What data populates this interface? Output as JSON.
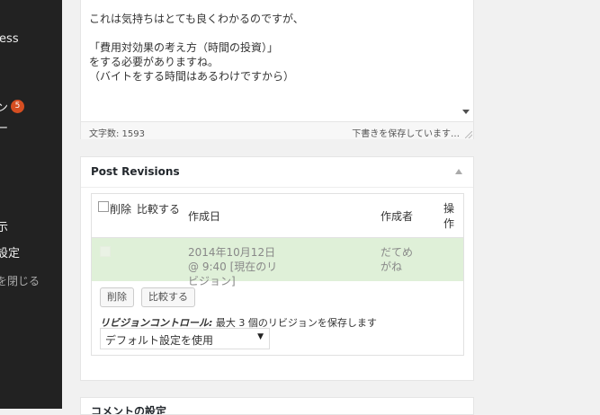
{
  "sidebar": {
    "brand": "ress",
    "plugins_label": "ン",
    "plugins_badge": "5",
    "users_label": "ー",
    "display_label": "示",
    "settings_label": "設定",
    "collapse_label": "を閉じる"
  },
  "editor": {
    "lines": [
      "これは気持ちはとても良くわかるのですが、",
      "",
      "「費用対効果の考え方（時間の投資）」",
      "をする必要がありますね。",
      "（バイトをする時間はあるわけですから）"
    ],
    "word_count": "文字数: 1593",
    "autosave": "下書きを保存しています…"
  },
  "revisions": {
    "title": "Post Revisions",
    "columns": {
      "delete": "削除",
      "compare": "比較する",
      "date": "作成日",
      "author": "作成者",
      "operation": "操作"
    },
    "rows": [
      {
        "date": "2014年10月12日 @ 9:40 [現在のリビジョン]",
        "author": "だてめがね"
      }
    ],
    "delete_button": "削除",
    "compare_button": "比較する",
    "control_label": "リビジョンコントロール:",
    "control_text": " 最大 3 個のリビジョンを保存します",
    "select_value": "デフォルト設定を使用",
    "select_arrow": "▼"
  },
  "next_box": {
    "title": "コメントの設定"
  },
  "colors": {
    "sidebar_bg": "#222222",
    "current_row_bg": "#dff0d8",
    "badge": "#d54e21"
  }
}
